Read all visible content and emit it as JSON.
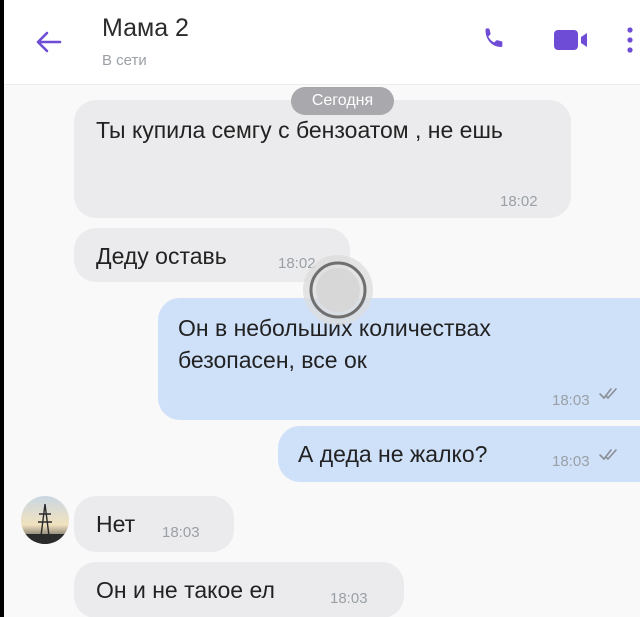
{
  "header": {
    "title": "Мама 2",
    "status": "В сети"
  },
  "chat": {
    "date_label": "Сегодня",
    "messages": [
      {
        "direction": "in",
        "text": "Ты купила семгу с бензоатом , не ешь",
        "time": "18:02"
      },
      {
        "direction": "in",
        "text": "Деду оставь",
        "time": "18:02"
      },
      {
        "direction": "out",
        "text": "Он в небольших количествах безопасен, все ок",
        "time": "18:03"
      },
      {
        "direction": "out",
        "text": "А деда не жалко?",
        "time": "18:03"
      },
      {
        "direction": "in",
        "text": "Нет",
        "time": "18:03"
      },
      {
        "direction": "in",
        "text": "Он и не такое ел",
        "time": "18:03"
      }
    ]
  },
  "colors": {
    "accent": "#6e4cd6",
    "incoming_bubble": "#ebebed",
    "outgoing_bubble": "#cfe0f9"
  },
  "icons": [
    "back-arrow-icon",
    "phone-icon",
    "video-camera-icon",
    "more-vertical-icon",
    "read-ticks-icon"
  ]
}
